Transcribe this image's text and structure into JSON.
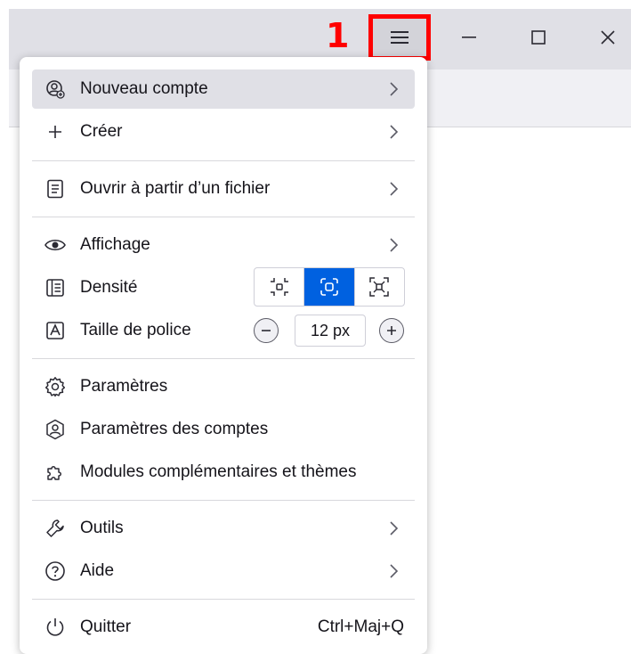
{
  "annotation": {
    "step_number": "1"
  },
  "window": {
    "menu_icon": "hamburger-icon",
    "minimize_icon": "minimize-icon",
    "maximize_icon": "maximize-icon",
    "close_icon": "close-icon"
  },
  "menu": {
    "items": [
      {
        "label": "Nouveau compte",
        "icon": "add-account-icon",
        "has_submenu": true,
        "hovered": true
      },
      {
        "label": "Créer",
        "icon": "plus-icon",
        "has_submenu": true
      },
      {
        "label": "Ouvrir à partir d’un fichier",
        "icon": "file-icon",
        "has_submenu": true
      },
      {
        "label": "Affichage",
        "icon": "eye-icon",
        "has_submenu": true
      },
      {
        "label": "Densité",
        "icon": "density-icon"
      },
      {
        "label": "Taille de police",
        "icon": "font-size-icon"
      },
      {
        "label": "Paramètres",
        "icon": "gear-icon"
      },
      {
        "label": "Paramètres des comptes",
        "icon": "account-settings-icon"
      },
      {
        "label": "Modules complémentaires et thèmes",
        "icon": "puzzle-icon"
      },
      {
        "label": "Outils",
        "icon": "wrench-icon",
        "has_submenu": true
      },
      {
        "label": "Aide",
        "icon": "help-icon",
        "has_submenu": true
      },
      {
        "label": "Quitter",
        "icon": "power-icon",
        "shortcut": "Ctrl+Maj+Q"
      }
    ],
    "density": {
      "options": [
        "compact",
        "normal",
        "touch"
      ],
      "selected": "normal"
    },
    "font_size": {
      "value": "12 px"
    }
  },
  "colors": {
    "accent": "#0061e0",
    "highlight_red": "#ff0000",
    "hover_bg": "#e0e0e6"
  }
}
